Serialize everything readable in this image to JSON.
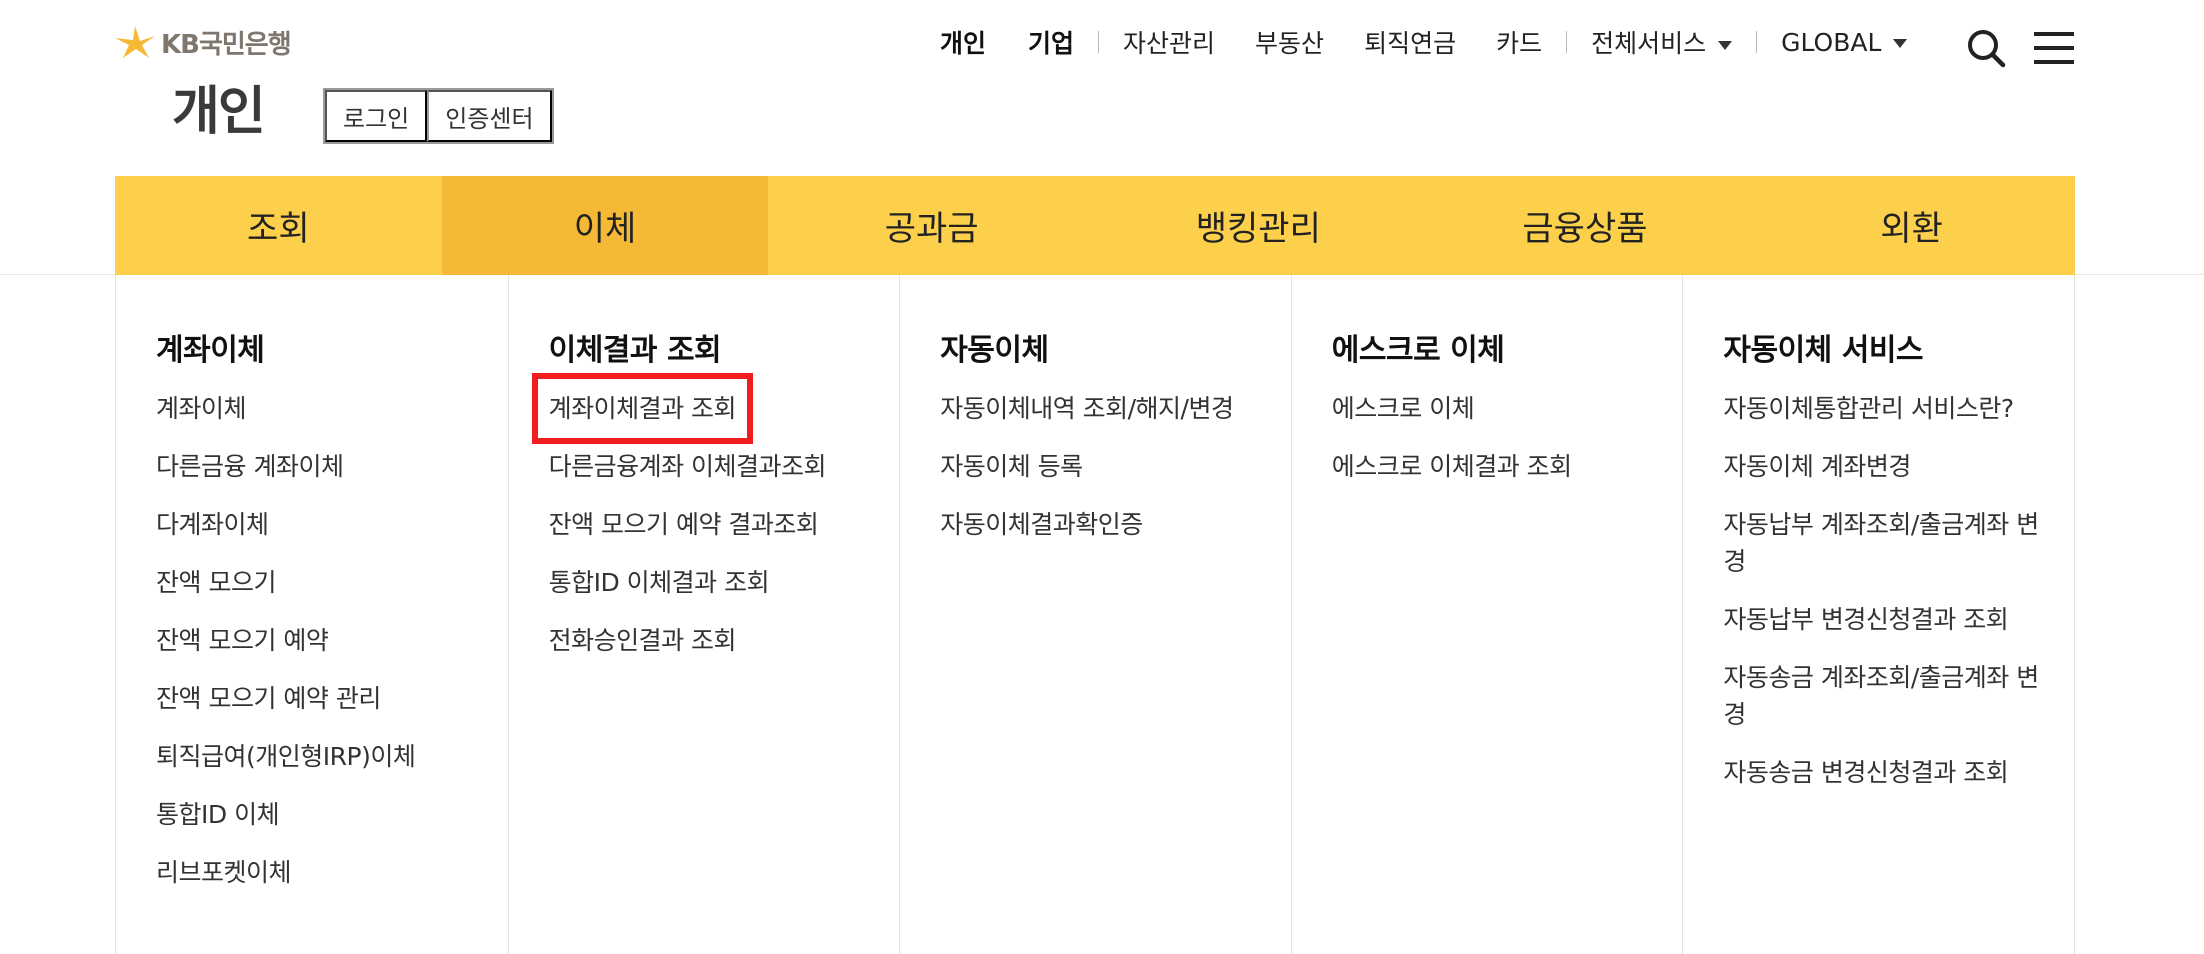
{
  "logo": {
    "text": "KB국민은행",
    "icon": "kb-star-logo-icon",
    "color": "#f6b936"
  },
  "gnb": {
    "personal": "개인",
    "business": "기업",
    "asset": "자산관리",
    "realestate": "부동산",
    "pension": "퇴직연금",
    "card": "카드",
    "all_services": "전체서비스",
    "global": "GLOBAL"
  },
  "icons": {
    "search": "search-icon",
    "menu": "hamburger-menu-icon",
    "dropdown": "caret-down-icon"
  },
  "header": {
    "title": "개인",
    "login": "로그인",
    "cert_center": "인증센터"
  },
  "main_menu": {
    "tabs": [
      {
        "label": "조회"
      },
      {
        "label": "이체",
        "active": true
      },
      {
        "label": "공과금"
      },
      {
        "label": "뱅킹관리"
      },
      {
        "label": "금융상품"
      },
      {
        "label": "외환"
      }
    ]
  },
  "colors": {
    "menu_bg": "#fdd04b",
    "menu_active": "#f6b936",
    "highlight": "#f01e1e"
  },
  "submenu": {
    "columns": [
      {
        "title": "계좌이체",
        "items": [
          "계좌이체",
          "다른금융 계좌이체",
          "다계좌이체",
          "잔액 모으기",
          "잔액 모으기 예약",
          "잔액 모으기 예약 관리",
          "퇴직급여(개인형IRP)이체",
          "통합ID 이체",
          "리브포켓이체"
        ]
      },
      {
        "title": "이체결과 조회",
        "items": [
          "계좌이체결과 조회",
          "다른금융계좌 이체결과조회",
          "잔액 모으기 예약 결과조회",
          "통합ID 이체결과 조회",
          "전화승인결과 조회"
        ],
        "highlighted_item": "계좌이체결과 조회"
      },
      {
        "title": "자동이체",
        "items": [
          "자동이체내역 조회/해지/변경",
          "자동이체 등록",
          "자동이체결과확인증"
        ]
      },
      {
        "title": "에스크로 이체",
        "items": [
          "에스크로 이체",
          "에스크로 이체결과 조회"
        ]
      },
      {
        "title": "자동이체 서비스",
        "items": [
          "자동이체통합관리 서비스란?",
          "자동이체 계좌변경",
          "자동납부 계좌조회/출금계좌 변경",
          "자동납부 변경신청결과 조회",
          "자동송금 계좌조회/출금계좌 변경",
          "자동송금 변경신청결과 조회"
        ]
      }
    ]
  }
}
